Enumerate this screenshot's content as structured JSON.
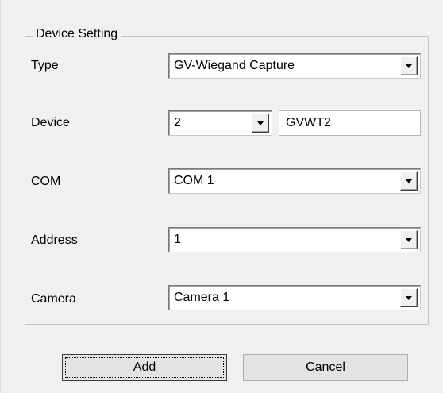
{
  "group": {
    "title": "Device Setting"
  },
  "fields": {
    "type": {
      "label": "Type",
      "value": "GV-Wiegand Capture"
    },
    "device": {
      "label": "Device",
      "value": "2",
      "name_value": "GVWT2"
    },
    "com": {
      "label": "COM",
      "value": "COM 1"
    },
    "address": {
      "label": "Address",
      "value": "1"
    },
    "camera": {
      "label": "Camera",
      "value": "Camera 1"
    }
  },
  "buttons": {
    "add": "Add",
    "cancel": "Cancel"
  }
}
